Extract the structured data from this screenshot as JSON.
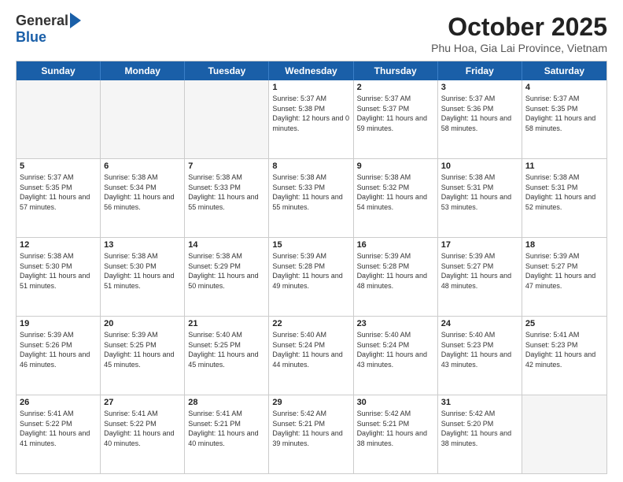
{
  "logo": {
    "general": "General",
    "blue": "Blue"
  },
  "title": "October 2025",
  "subtitle": "Phu Hoa, Gia Lai Province, Vietnam",
  "days_of_week": [
    "Sunday",
    "Monday",
    "Tuesday",
    "Wednesday",
    "Thursday",
    "Friday",
    "Saturday"
  ],
  "weeks": [
    [
      {
        "day": "",
        "empty": true
      },
      {
        "day": "",
        "empty": true
      },
      {
        "day": "",
        "empty": true
      },
      {
        "day": "1",
        "sunrise": "5:37 AM",
        "sunset": "5:38 PM",
        "daylight": "12 hours and 0 minutes."
      },
      {
        "day": "2",
        "sunrise": "5:37 AM",
        "sunset": "5:37 PM",
        "daylight": "11 hours and 59 minutes."
      },
      {
        "day": "3",
        "sunrise": "5:37 AM",
        "sunset": "5:36 PM",
        "daylight": "11 hours and 58 minutes."
      },
      {
        "day": "4",
        "sunrise": "5:37 AM",
        "sunset": "5:35 PM",
        "daylight": "11 hours and 58 minutes."
      }
    ],
    [
      {
        "day": "5",
        "sunrise": "5:37 AM",
        "sunset": "5:35 PM",
        "daylight": "11 hours and 57 minutes."
      },
      {
        "day": "6",
        "sunrise": "5:38 AM",
        "sunset": "5:34 PM",
        "daylight": "11 hours and 56 minutes."
      },
      {
        "day": "7",
        "sunrise": "5:38 AM",
        "sunset": "5:33 PM",
        "daylight": "11 hours and 55 minutes."
      },
      {
        "day": "8",
        "sunrise": "5:38 AM",
        "sunset": "5:33 PM",
        "daylight": "11 hours and 55 minutes."
      },
      {
        "day": "9",
        "sunrise": "5:38 AM",
        "sunset": "5:32 PM",
        "daylight": "11 hours and 54 minutes."
      },
      {
        "day": "10",
        "sunrise": "5:38 AM",
        "sunset": "5:31 PM",
        "daylight": "11 hours and 53 minutes."
      },
      {
        "day": "11",
        "sunrise": "5:38 AM",
        "sunset": "5:31 PM",
        "daylight": "11 hours and 52 minutes."
      }
    ],
    [
      {
        "day": "12",
        "sunrise": "5:38 AM",
        "sunset": "5:30 PM",
        "daylight": "11 hours and 51 minutes."
      },
      {
        "day": "13",
        "sunrise": "5:38 AM",
        "sunset": "5:30 PM",
        "daylight": "11 hours and 51 minutes."
      },
      {
        "day": "14",
        "sunrise": "5:38 AM",
        "sunset": "5:29 PM",
        "daylight": "11 hours and 50 minutes."
      },
      {
        "day": "15",
        "sunrise": "5:39 AM",
        "sunset": "5:28 PM",
        "daylight": "11 hours and 49 minutes."
      },
      {
        "day": "16",
        "sunrise": "5:39 AM",
        "sunset": "5:28 PM",
        "daylight": "11 hours and 48 minutes."
      },
      {
        "day": "17",
        "sunrise": "5:39 AM",
        "sunset": "5:27 PM",
        "daylight": "11 hours and 48 minutes."
      },
      {
        "day": "18",
        "sunrise": "5:39 AM",
        "sunset": "5:27 PM",
        "daylight": "11 hours and 47 minutes."
      }
    ],
    [
      {
        "day": "19",
        "sunrise": "5:39 AM",
        "sunset": "5:26 PM",
        "daylight": "11 hours and 46 minutes."
      },
      {
        "day": "20",
        "sunrise": "5:39 AM",
        "sunset": "5:25 PM",
        "daylight": "11 hours and 45 minutes."
      },
      {
        "day": "21",
        "sunrise": "5:40 AM",
        "sunset": "5:25 PM",
        "daylight": "11 hours and 45 minutes."
      },
      {
        "day": "22",
        "sunrise": "5:40 AM",
        "sunset": "5:24 PM",
        "daylight": "11 hours and 44 minutes."
      },
      {
        "day": "23",
        "sunrise": "5:40 AM",
        "sunset": "5:24 PM",
        "daylight": "11 hours and 43 minutes."
      },
      {
        "day": "24",
        "sunrise": "5:40 AM",
        "sunset": "5:23 PM",
        "daylight": "11 hours and 43 minutes."
      },
      {
        "day": "25",
        "sunrise": "5:41 AM",
        "sunset": "5:23 PM",
        "daylight": "11 hours and 42 minutes."
      }
    ],
    [
      {
        "day": "26",
        "sunrise": "5:41 AM",
        "sunset": "5:22 PM",
        "daylight": "11 hours and 41 minutes."
      },
      {
        "day": "27",
        "sunrise": "5:41 AM",
        "sunset": "5:22 PM",
        "daylight": "11 hours and 40 minutes."
      },
      {
        "day": "28",
        "sunrise": "5:41 AM",
        "sunset": "5:21 PM",
        "daylight": "11 hours and 40 minutes."
      },
      {
        "day": "29",
        "sunrise": "5:42 AM",
        "sunset": "5:21 PM",
        "daylight": "11 hours and 39 minutes."
      },
      {
        "day": "30",
        "sunrise": "5:42 AM",
        "sunset": "5:21 PM",
        "daylight": "11 hours and 38 minutes."
      },
      {
        "day": "31",
        "sunrise": "5:42 AM",
        "sunset": "5:20 PM",
        "daylight": "11 hours and 38 minutes."
      },
      {
        "day": "",
        "empty": true
      }
    ]
  ]
}
